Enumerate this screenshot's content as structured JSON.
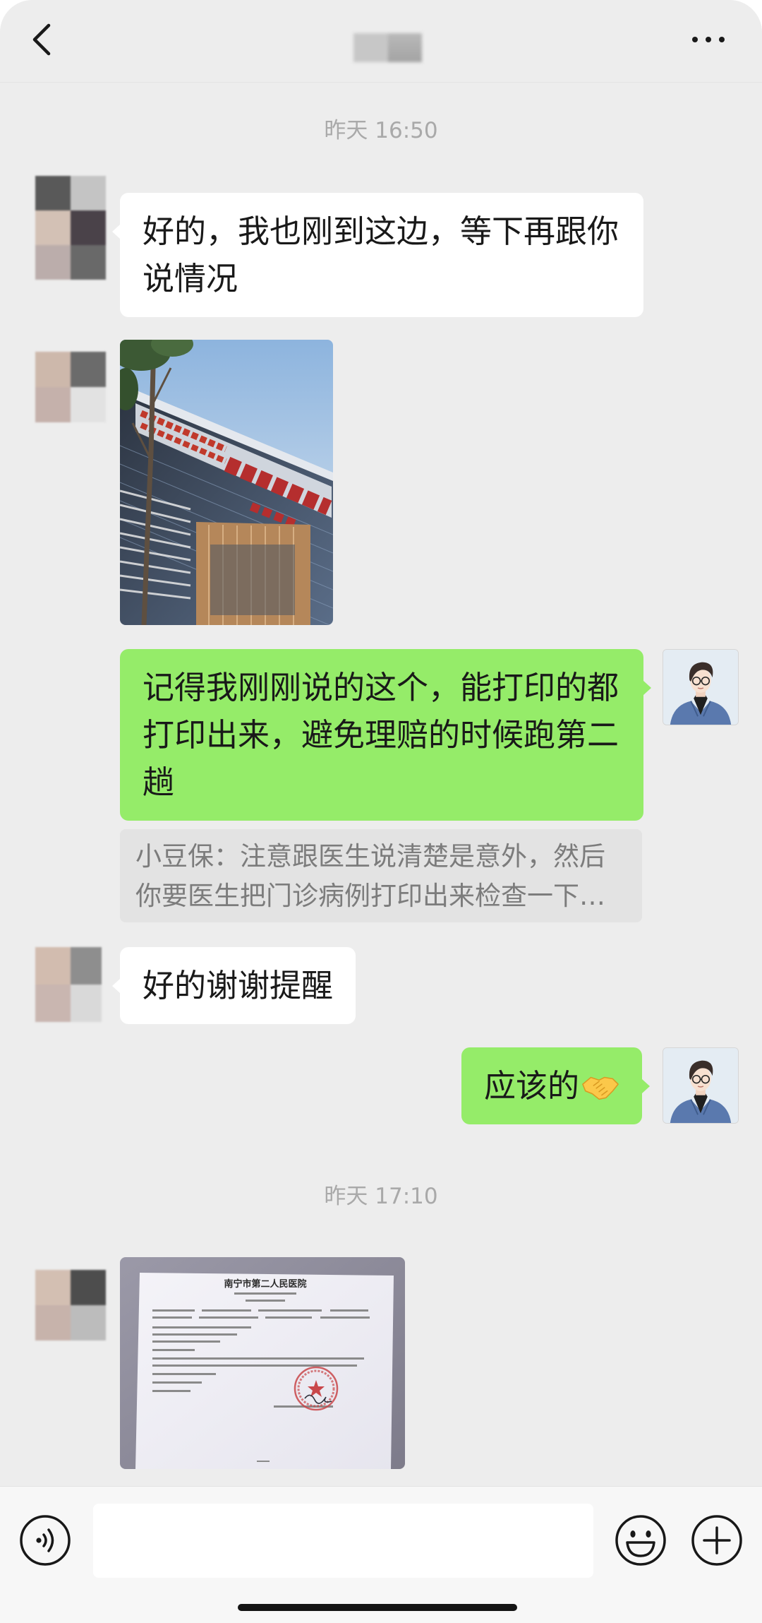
{
  "header": {
    "back_icon": "chevron-left-icon",
    "more_icon": "more-horizontal-icon"
  },
  "chat": {
    "timestamps": [
      "昨天 16:50",
      "昨天 17:10"
    ],
    "messages": [
      {
        "outgoing": false,
        "text": "好的，我也刚到这边，等下再跟你说情况"
      },
      {
        "outgoing": false,
        "image": true
      },
      {
        "outgoing": true,
        "text": "记得我刚刚说的这个，能打印的都打印出来，避免理赔的时候跑第二趟",
        "quote": "小豆保：注意跟医生说清楚是意外，然后你要医生把门诊病例打印出来检查一下…"
      },
      {
        "outgoing": false,
        "text": "好的谢谢提醒"
      },
      {
        "outgoing": true,
        "text": "应该的",
        "emoji_icon": "handshake-icon"
      },
      {
        "outgoing": false,
        "image": true,
        "document_title": "南宁市第二人民医院"
      }
    ]
  },
  "input_bar": {
    "voice_icon": "voice-icon",
    "emoji_icon": "smiley-icon",
    "plus_icon": "plus-circle-icon",
    "input_value": ""
  },
  "colors": {
    "chat_background": "#ededed",
    "outgoing_bubble": "#95ec69",
    "incoming_bubble": "#ffffff",
    "quote_background": "#e3e3e3",
    "timestamp_text": "#a9a9a9"
  }
}
